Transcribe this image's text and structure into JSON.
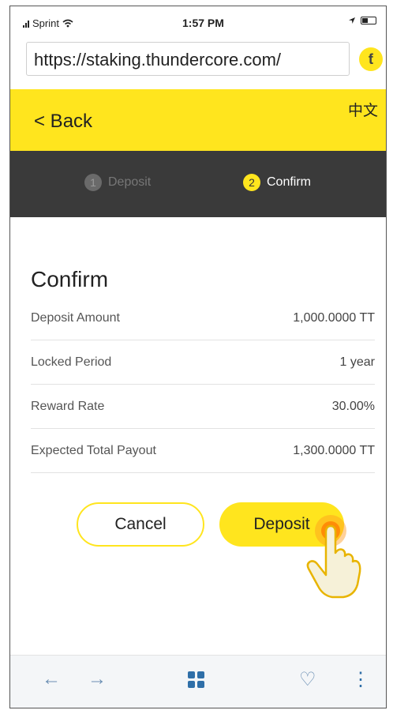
{
  "status_bar": {
    "carrier": "Sprint",
    "time": "1:57 PM"
  },
  "browser": {
    "url": "https://staking.thundercore.com/",
    "site_icon_glyph": "ƭ",
    "toolbar": {
      "back_icon": "←",
      "forward_icon": "→",
      "favorite_icon": "♡",
      "menu_icon": "⋮"
    }
  },
  "header": {
    "back_label": "< Back",
    "language_label": "中文",
    "accent_color": "#ffe51e"
  },
  "steps": [
    {
      "number": "1",
      "label": "Deposit",
      "state": "completed"
    },
    {
      "number": "2",
      "label": "Confirm",
      "state": "active"
    }
  ],
  "confirm": {
    "title": "Confirm",
    "rows": [
      {
        "label": "Deposit Amount",
        "value": "1,000.0000 TT"
      },
      {
        "label": "Locked Period",
        "value": "1 year"
      },
      {
        "label": "Reward Rate",
        "value": "30.00%"
      },
      {
        "label": "Expected Total Payout",
        "value": "1,300.0000 TT"
      }
    ]
  },
  "actions": {
    "cancel_label": "Cancel",
    "deposit_label": "Deposit"
  }
}
